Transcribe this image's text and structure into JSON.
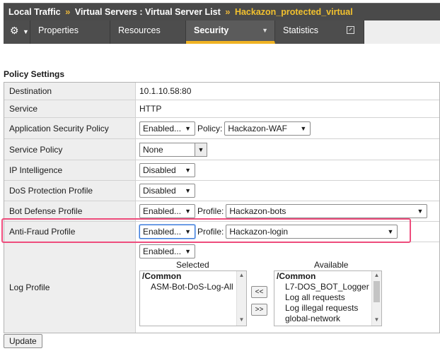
{
  "breadcrumb": {
    "items": [
      "Local Traffic",
      "Virtual Servers : Virtual Server List"
    ],
    "current": "Hackazon_protected_virtual",
    "separator": "»"
  },
  "tabs": [
    {
      "label": "",
      "icon": "gear-icon"
    },
    {
      "label": "Properties"
    },
    {
      "label": "Resources"
    },
    {
      "label": "Security",
      "active": true
    },
    {
      "label": "Statistics",
      "icon": "external-link-icon"
    }
  ],
  "section_title": "Policy Settings",
  "settings": {
    "destination": {
      "label": "Destination",
      "value": "10.1.10.58:80"
    },
    "service": {
      "label": "Service",
      "value": "HTTP"
    },
    "asp": {
      "label": "Application Security Policy",
      "state": "Enabled...",
      "policy_label": "Policy:",
      "policy": "Hackazon-WAF"
    },
    "service_policy": {
      "label": "Service Policy",
      "value": "None"
    },
    "ip_intel": {
      "label": "IP Intelligence",
      "state": "Disabled"
    },
    "dos": {
      "label": "DoS Protection Profile",
      "state": "Disabled"
    },
    "bot": {
      "label": "Bot Defense Profile",
      "state": "Enabled...",
      "profile_label": "Profile:",
      "profile": "Hackazon-bots"
    },
    "antifraud": {
      "label": "Anti-Fraud Profile",
      "state": "Enabled...",
      "profile_label": "Profile:",
      "profile": "Hackazon-login"
    },
    "log": {
      "label": "Log Profile",
      "state": "Enabled...",
      "selected_label": "Selected",
      "available_label": "Available",
      "selected": [
        "/Common",
        "ASM-Bot-DoS-Log-All"
      ],
      "available": [
        "/Common",
        "L7-DOS_BOT_Logger",
        "Log all requests",
        "Log illegal requests",
        "global-network"
      ],
      "move_left": "<<",
      "move_right": ">>"
    }
  },
  "update_button": "Update",
  "colors": {
    "accent": "#f0b323",
    "highlight": "#ee4c7c",
    "titlebar": "#4a4a4a"
  }
}
